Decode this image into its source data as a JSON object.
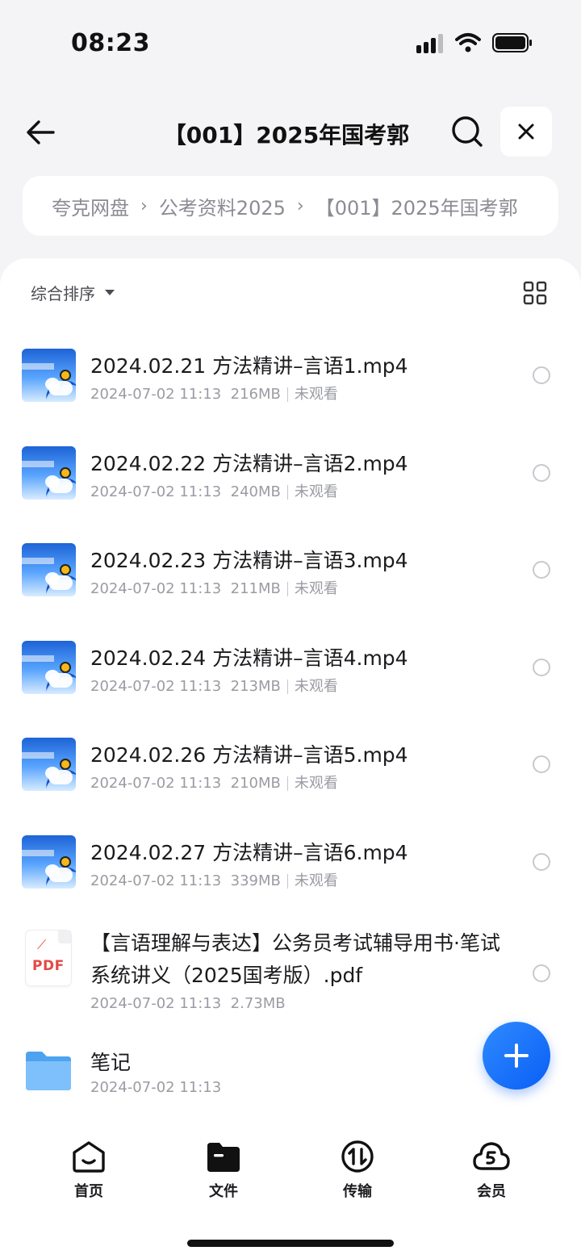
{
  "status": {
    "time": "08:23"
  },
  "header": {
    "title": "【001】2025年国考郭"
  },
  "breadcrumb": [
    {
      "label": "夸克网盘"
    },
    {
      "label": "公考资料2025"
    },
    {
      "label": "【001】2025年国考郭"
    }
  ],
  "toolbar": {
    "sort_label": "综合排序"
  },
  "files": [
    {
      "name": "2024.02.21 方法精讲–言语1.mp4",
      "date": "2024-07-02 11:13",
      "size": "216MB",
      "status": "未观看"
    },
    {
      "name": "2024.02.22 方法精讲–言语2.mp4",
      "date": "2024-07-02 11:13",
      "size": "240MB",
      "status": "未观看"
    },
    {
      "name": "2024.02.23 方法精讲–言语3.mp4",
      "date": "2024-07-02 11:13",
      "size": "211MB",
      "status": "未观看"
    },
    {
      "name": "2024.02.24 方法精讲–言语4.mp4",
      "date": "2024-07-02 11:13",
      "size": "213MB",
      "status": "未观看"
    },
    {
      "name": "2024.02.26 方法精讲–言语5.mp4",
      "date": "2024-07-02 11:13",
      "size": "210MB",
      "status": "未观看"
    },
    {
      "name": "2024.02.27 方法精讲–言语6.mp4",
      "date": "2024-07-02 11:13",
      "size": "339MB",
      "status": "未观看"
    }
  ],
  "pdf_file": {
    "name": "【言语理解与表达】公务员考试辅导用书·笔试系统讲义（2025国考版）.pdf",
    "date": "2024-07-02 11:13",
    "size": "2.73MB",
    "icon_label": "PDF"
  },
  "folder": {
    "name": "笔记",
    "date": "2024-07-02 11:13"
  },
  "nav": [
    {
      "label": "首页"
    },
    {
      "label": "文件"
    },
    {
      "label": "传输"
    },
    {
      "label": "会员"
    }
  ],
  "colors": {
    "accent": "#0a5ef5",
    "pdf": "#e24a43"
  }
}
